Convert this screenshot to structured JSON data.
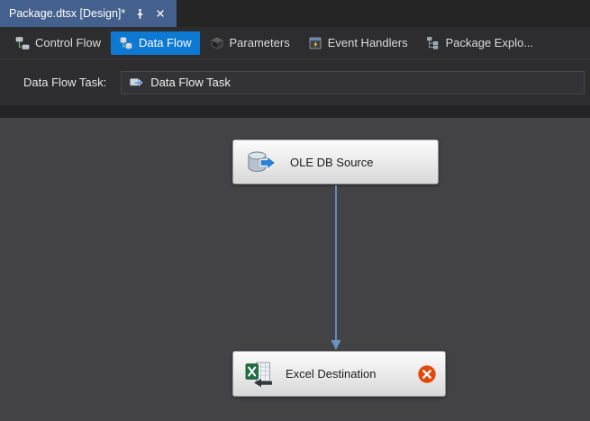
{
  "doc_tab": {
    "title": "Package.dtsx [Design]*"
  },
  "view_tabs": [
    {
      "label": "Control Flow",
      "selected": false
    },
    {
      "label": "Data Flow",
      "selected": true
    },
    {
      "label": "Parameters",
      "selected": false
    },
    {
      "label": "Event Handlers",
      "selected": false
    },
    {
      "label": "Package Explo...",
      "selected": false
    }
  ],
  "task_selector": {
    "label": "Data Flow Task:",
    "value": "Data Flow Task"
  },
  "canvas": {
    "source": {
      "label": "OLE DB Source"
    },
    "destination": {
      "label": "Excel Destination",
      "has_error": true
    }
  },
  "colors": {
    "doc_tab_bg": "#44618d",
    "selected_tab_bg": "#0e79d2",
    "connector": "#6a93c4",
    "error_badge_bg": "#e2470c",
    "excel_green": "#1e7145"
  }
}
